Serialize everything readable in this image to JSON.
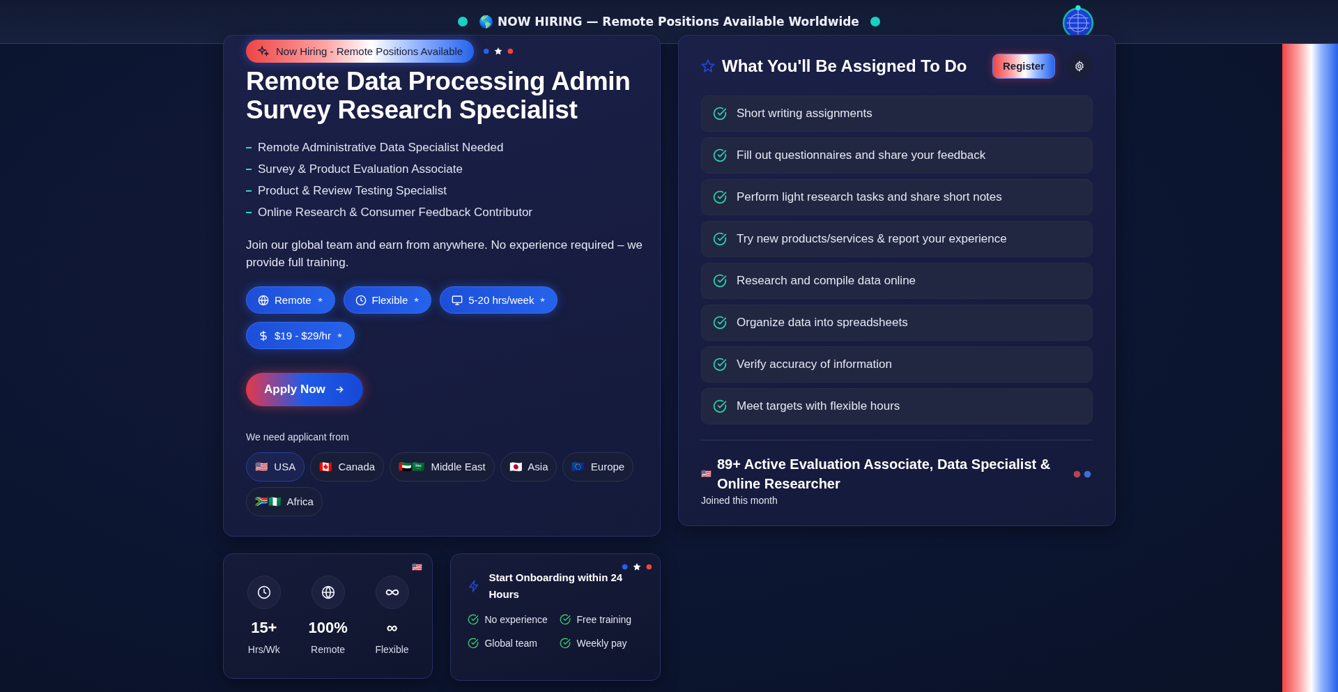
{
  "banner": {
    "icon": "🌎",
    "text": "NOW HIRING — Remote Positions Available Worldwide"
  },
  "job": {
    "badge": "Now Hiring - Remote Positions Available",
    "title": "Remote Data Processing Admin Survey Research Specialist",
    "roles": [
      "Remote Administrative Data Specialist Needed",
      "Survey & Product Evaluation Associate",
      "Product & Review Testing Specialist",
      "Online Research & Consumer Feedback Contributor"
    ],
    "description": "Join our global team and earn from anywhere. No experience required – we provide full training.",
    "tags": [
      {
        "kind": "globe",
        "label": "Remote"
      },
      {
        "kind": "clock",
        "label": "Flexible"
      },
      {
        "kind": "monitor",
        "label": "5-20 hrs/week"
      },
      {
        "kind": "dollar",
        "label": "$19 - $29/hr"
      }
    ],
    "apply_button": "Apply Now",
    "regions_label": "We need applicant from",
    "regions": [
      {
        "flag": "🇺🇸",
        "name": "USA",
        "selected": true
      },
      {
        "flag": "🇨🇦",
        "name": "Canada",
        "selected": false
      },
      {
        "flag": "🇦🇪🇸🇦",
        "name": "Middle East",
        "selected": false
      },
      {
        "flag": "🇯🇵",
        "name": "Asia",
        "selected": false
      },
      {
        "flag": "🇪🇺",
        "name": "Europe",
        "selected": false
      },
      {
        "flag": "🇿🇦🇳🇬",
        "name": "Africa",
        "selected": false
      }
    ]
  },
  "stats": {
    "flag": "🇺🇸",
    "items": [
      {
        "kind": "clock",
        "value": "15+",
        "label": "Hrs/Wk"
      },
      {
        "kind": "globe",
        "value": "100%",
        "label": "Remote"
      },
      {
        "kind": "infinity",
        "value": "∞",
        "label": "Flexible"
      }
    ]
  },
  "onboarding": {
    "title": "Start Onboarding within 24 Hours",
    "perks": [
      "No experience",
      "Free training",
      "Global team",
      "Weekly pay"
    ]
  },
  "tasks": {
    "title": "What You'll Be Assigned To Do",
    "register_button": "Register",
    "items": [
      "Short writing assignments",
      "Fill out questionnaires and share your feedback",
      "Perform light research tasks and share short notes",
      "Try new products/services & report your experience",
      "Research and compile data online",
      "Organize data into spreadsheets",
      "Verify accuracy of information",
      "Meet targets with flexible hours"
    ],
    "footer": {
      "flag": "🇺🇸",
      "headline": "89+ Active Evaluation Associate, Data Specialist & Online Researcher",
      "note": "Joined this month"
    }
  }
}
